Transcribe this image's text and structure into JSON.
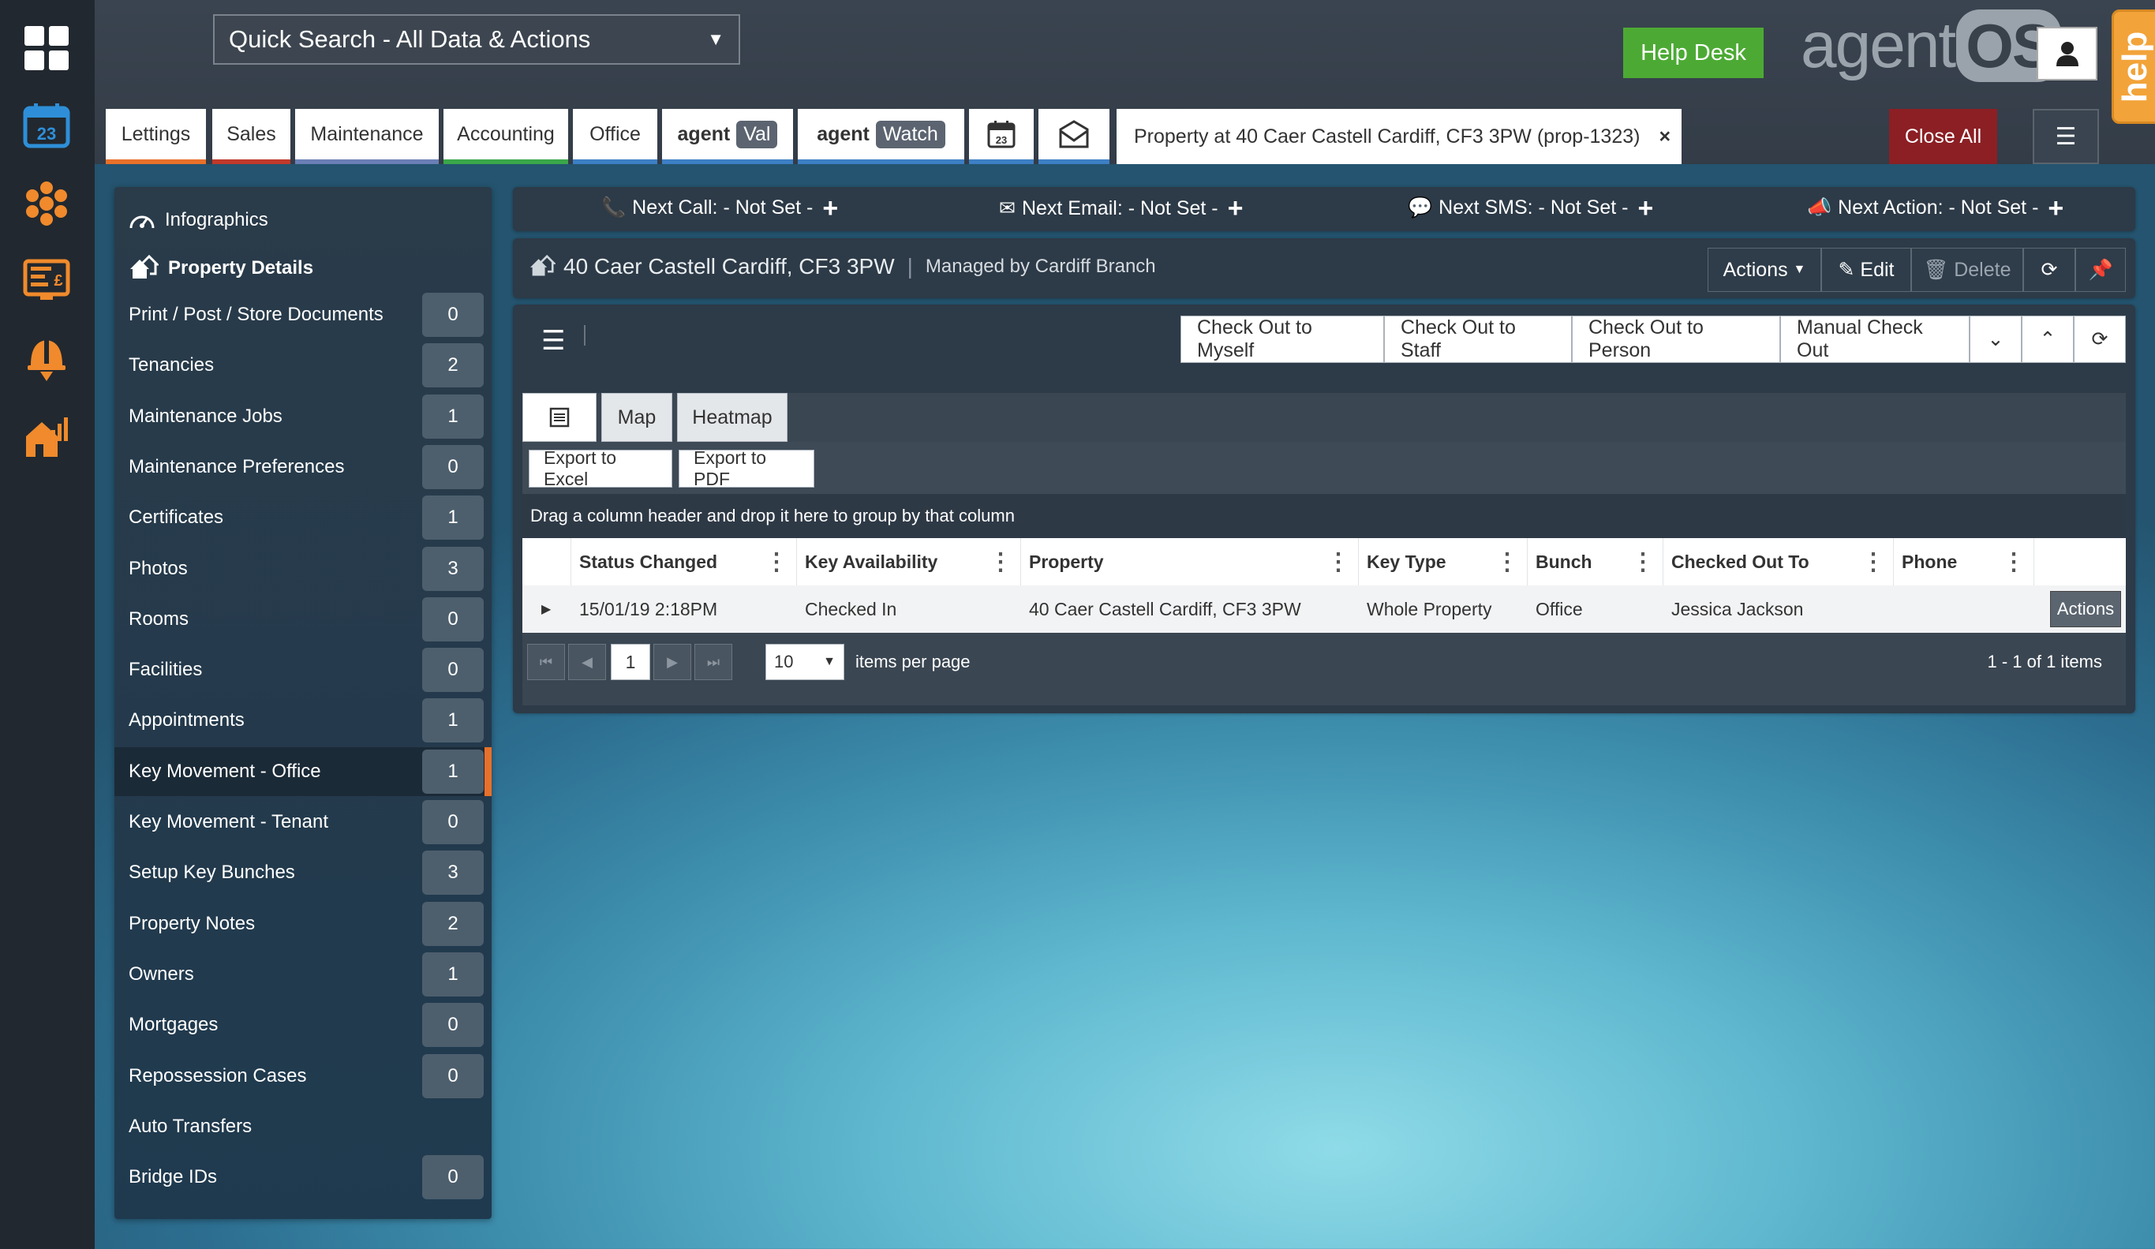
{
  "search": {
    "label": "Quick Search - All Data & Actions"
  },
  "header": {
    "help_desk": "Help Desk",
    "logo_text": "agent",
    "logo_os": "OS",
    "help_tab": "help"
  },
  "tabs": [
    {
      "label": "Lettings",
      "color": "#e8702a"
    },
    {
      "label": "Sales",
      "color": "#c0392b"
    },
    {
      "label": "Maintenance",
      "color": "#6a7fb5"
    },
    {
      "label": "Accounting",
      "color": "#3aa64a"
    },
    {
      "label": "Office",
      "color": "#3d7fc4"
    },
    {
      "prefix": "agent",
      "tag": "Val",
      "color": "#3d7fc4"
    },
    {
      "prefix": "agent",
      "tag": "Watch",
      "color": "#3d7fc4"
    }
  ],
  "record_tab": {
    "label": "Property at 40 Caer Castell Cardiff, CF3 3PW (prop-1323)",
    "close": "×"
  },
  "close_all": "Close All",
  "sidebar": {
    "infographics": "Infographics",
    "property_details": "Property Details",
    "items": [
      {
        "label": "Print / Post / Store Documents",
        "count": "0"
      },
      {
        "label": "Tenancies",
        "count": "2"
      },
      {
        "label": "Maintenance Jobs",
        "count": "1"
      },
      {
        "label": "Maintenance Preferences",
        "count": "0"
      },
      {
        "label": "Certificates",
        "count": "1"
      },
      {
        "label": "Photos",
        "count": "3"
      },
      {
        "label": "Rooms",
        "count": "0"
      },
      {
        "label": "Facilities",
        "count": "0"
      },
      {
        "label": "Appointments",
        "count": "1"
      },
      {
        "label": "Key Movement - Office",
        "count": "1"
      },
      {
        "label": "Key Movement - Tenant",
        "count": "0"
      },
      {
        "label": "Setup Key Bunches",
        "count": "3"
      },
      {
        "label": "Property Notes",
        "count": "2"
      },
      {
        "label": "Owners",
        "count": "1"
      },
      {
        "label": "Mortgages",
        "count": "0"
      },
      {
        "label": "Repossession Cases",
        "count": "0"
      },
      {
        "label": "Auto Transfers",
        "count": ""
      },
      {
        "label": "Bridge IDs",
        "count": "0"
      }
    ]
  },
  "next": {
    "call": "Next Call: - Not Set -",
    "email": "Next Email: - Not Set -",
    "sms": "Next SMS: - Not Set -",
    "action": "Next Action: - Not Set -",
    "plus": "+"
  },
  "property": {
    "title": "40 Caer Castell Cardiff, CF3 3PW",
    "sep": "|",
    "managed": "Managed by Cardiff Branch",
    "actions": "Actions",
    "edit": "Edit",
    "delete": "Delete"
  },
  "checkout": {
    "myself": "Check Out to Myself",
    "staff": "Check Out to Staff",
    "person": "Check Out to Person",
    "manual": "Manual Check Out"
  },
  "grid": {
    "tabs": {
      "map": "Map",
      "heatmap": "Heatmap"
    },
    "export_excel": "Export to Excel",
    "export_pdf": "Export to PDF",
    "group_hint": "Drag a column header and drop it here to group by that column",
    "columns": [
      "Status Changed",
      "Key Availability",
      "Property",
      "Key Type",
      "Bunch",
      "Checked Out To",
      "Phone"
    ],
    "rows": [
      {
        "status_changed": "15/01/19 2:18PM",
        "key_availability": "Checked In",
        "property": "40 Caer Castell Cardiff, CF3 3PW",
        "key_type": "Whole Property",
        "bunch": "Office",
        "checked_out_to": "Jessica Jackson",
        "phone": "",
        "actions": "Actions"
      }
    ],
    "pager": {
      "current_page": "1",
      "page_size": "10",
      "page_size_label": "items per page",
      "info": "1 - 1 of 1 items"
    }
  }
}
